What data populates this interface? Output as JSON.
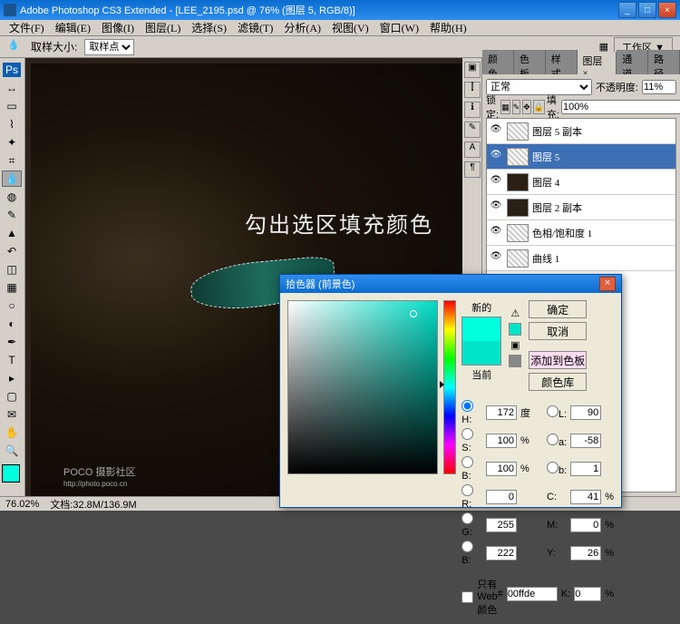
{
  "titlebar": {
    "app": "Adobe Photoshop CS3 Extended",
    "doc": "[LEE_2195.psd @ 76% (图层 5, RGB/8)]"
  },
  "menu": [
    "文件(F)",
    "编辑(E)",
    "图像(I)",
    "图层(L)",
    "选择(S)",
    "滤镜(T)",
    "分析(A)",
    "视图(V)",
    "窗口(W)",
    "帮助(H)"
  ],
  "options": {
    "samplesize_label": "取样大小:",
    "samplesize_value": "取样点",
    "workspace": "工作区 ▼"
  },
  "instruction": "勾出选区填充颜色",
  "watermark": "POCO 摄影社区",
  "watermark2": "http://photo.poco.cn",
  "status": {
    "zoom": "76.02%",
    "docsize": "文档:32.8M/136.9M"
  },
  "panels": {
    "tabsrow": [
      "颜色",
      "色板",
      "样式",
      "图层 ×",
      "通道",
      "路径"
    ],
    "blend": {
      "mode": "正常",
      "opacity_label": "不透明度:",
      "opacity": "11%",
      "lock_label": "锁定:",
      "fill_label": "填充:",
      "fill": "100%"
    },
    "layers": [
      {
        "name": "图层 5 副本",
        "sel": false,
        "thumb": "checker"
      },
      {
        "name": "图层 5",
        "sel": true,
        "thumb": "checker"
      },
      {
        "name": "图层 4",
        "sel": false,
        "thumb": "img"
      },
      {
        "name": "图层 2 副本",
        "sel": false,
        "thumb": "img"
      },
      {
        "name": "色相/饱和度 1",
        "sel": false,
        "thumb": "checker"
      },
      {
        "name": "曲线 1",
        "sel": false,
        "thumb": "checker"
      }
    ]
  },
  "colorpicker": {
    "title": "拾色器 (前景色)",
    "new_label": "新的",
    "current_label": "当前",
    "ok": "确定",
    "cancel": "取消",
    "addswatch": "添加到色板",
    "library": "颜色库",
    "h": "172",
    "s": "100",
    "b": "100",
    "r": "0",
    "g": "255",
    "bl": "222",
    "l": "90",
    "a": "-58",
    "lb": "1",
    "c": "41",
    "m": "0",
    "y": "26",
    "k": "0",
    "hex": "00ffde",
    "webonly": "只有 Web 颜色",
    "unit_deg": "度",
    "unit_pct": "%"
  },
  "colors": {
    "accent": "#00ffde",
    "titleblue": "#0a6cce",
    "selection": "#3d6fb5"
  }
}
